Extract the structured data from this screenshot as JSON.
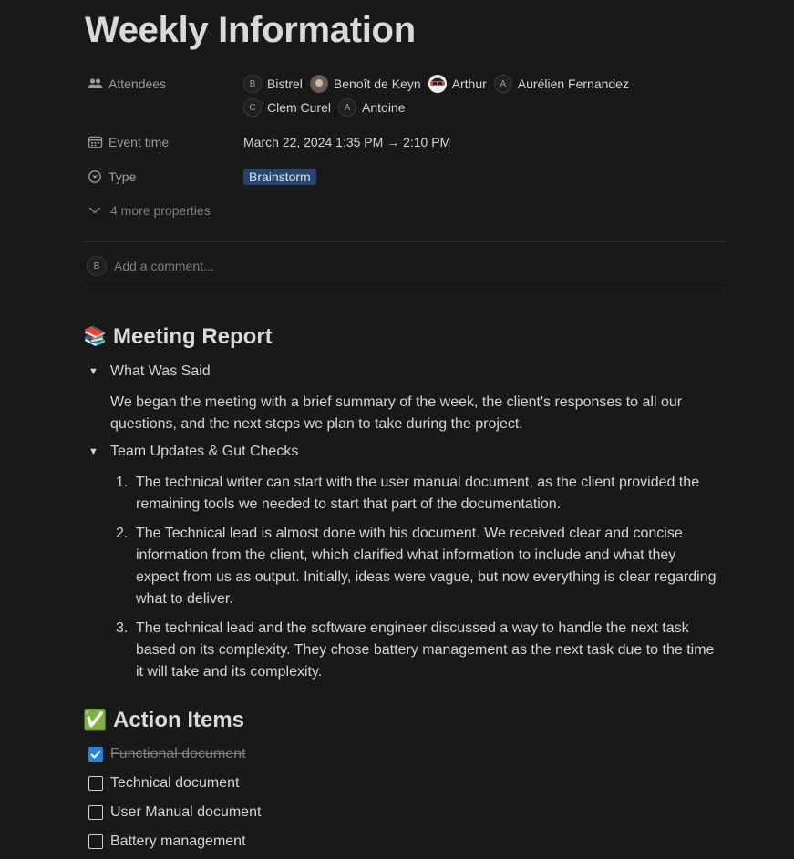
{
  "page": {
    "title": "Weekly Information"
  },
  "properties": {
    "attendees": {
      "label": "Attendees",
      "people": [
        {
          "name": "Bistrel",
          "initial": "B"
        },
        {
          "name": "Benoît de Keyn",
          "initial": ""
        },
        {
          "name": "Arthur",
          "initial": ""
        },
        {
          "name": "Aurélien Fernandez",
          "initial": "A"
        },
        {
          "name": "Clem Curel",
          "initial": "C"
        },
        {
          "name": "Antoine",
          "initial": "A"
        }
      ]
    },
    "event_time": {
      "label": "Event time",
      "value": "March 22, 2024 1:35 PM → 2:10 PM"
    },
    "type": {
      "label": "Type",
      "value": "Brainstorm"
    },
    "more": "4 more properties"
  },
  "comment": {
    "avatar_initial": "B",
    "placeholder": "Add a comment..."
  },
  "meeting_report": {
    "emoji": "📚",
    "heading": "Meeting Report",
    "toggle1": {
      "label": "What Was Said",
      "text": "We began the meeting with a brief summary of the week, the client's responses to all our questions, and the next steps we plan to take during the project."
    },
    "toggle2": {
      "label": "Team Updates & Gut Checks",
      "items": [
        {
          "num": "1.",
          "text": "The technical writer can start with the user manual document, as the client provided the remaining tools we needed to start that part of the documentation."
        },
        {
          "num": "2.",
          "text": "The Technical lead is almost done with his document. We received clear and concise information from the client, which clarified what information to include and what they expect from us as output. Initially, ideas were vague, but now everything is clear regarding what to deliver."
        },
        {
          "num": "3.",
          "text": "The technical lead and the software engineer discussed a way to handle the next task based on its complexity. They chose battery management as the next task due to the time it will take and its complexity."
        }
      ]
    }
  },
  "action_items": {
    "emoji": "✅",
    "heading": "Action Items",
    "items": [
      {
        "label": "Functional document",
        "checked": true
      },
      {
        "label": "Technical document",
        "checked": false
      },
      {
        "label": "User Manual document",
        "checked": false
      },
      {
        "label": "Battery management",
        "checked": false
      }
    ]
  },
  "colors": {
    "background": "#191919",
    "tag_bg": "#28456c",
    "checkbox_checked": "#2383e2"
  }
}
